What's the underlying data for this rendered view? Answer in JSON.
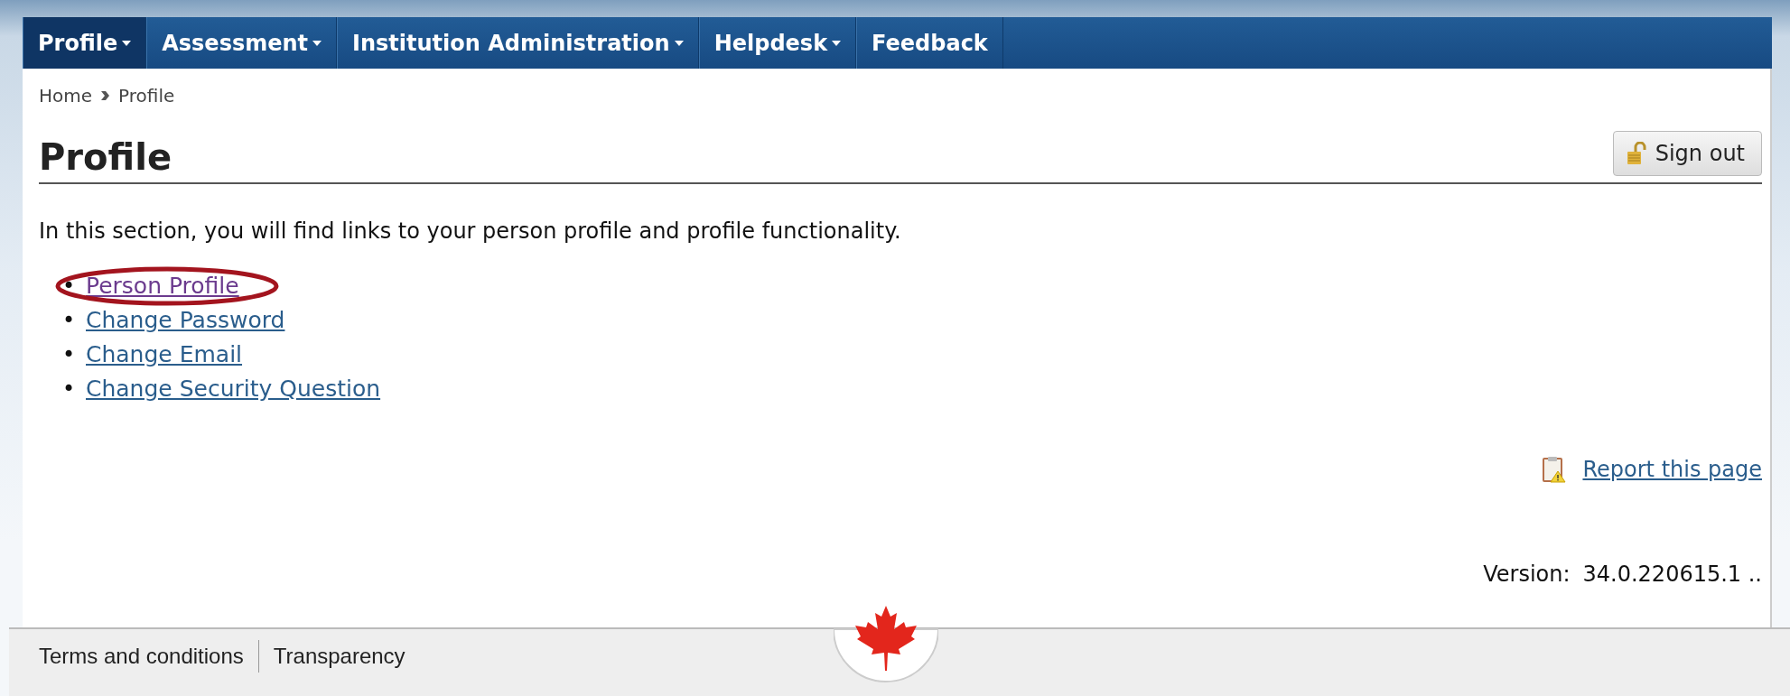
{
  "nav": {
    "items": [
      {
        "label": "Profile",
        "selected": true,
        "dropdown": true
      },
      {
        "label": "Assessment",
        "selected": false,
        "dropdown": true
      },
      {
        "label": "Institution Administration",
        "selected": false,
        "dropdown": true
      },
      {
        "label": "Helpdesk",
        "selected": false,
        "dropdown": true
      },
      {
        "label": "Feedback",
        "selected": false,
        "dropdown": false
      }
    ]
  },
  "breadcrumb": [
    "Home",
    "Profile"
  ],
  "page": {
    "title": "Profile",
    "sign_out": "Sign out"
  },
  "intro": "In this section, you will find links to your person profile and profile functionality.",
  "links": [
    {
      "bullet": "•",
      "label": "Person Profile",
      "visited": true,
      "highlighted": true
    },
    {
      "bullet": "•",
      "label": "Change Password",
      "visited": false,
      "highlighted": false
    },
    {
      "bullet": "•",
      "label": "Change Email",
      "visited": false,
      "highlighted": false
    },
    {
      "bullet": "•",
      "label": "Change Security Question",
      "visited": false,
      "highlighted": false
    }
  ],
  "report_link": "Report this page",
  "version": {
    "label": "Version:",
    "value": "34.0.220615.1 .."
  },
  "footer": {
    "links": [
      "Terms and conditions",
      "Transparency"
    ]
  }
}
